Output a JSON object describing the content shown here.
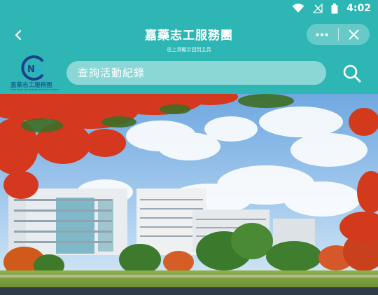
{
  "status_bar": {
    "time": "4:02"
  },
  "header": {
    "title": "嘉藥志工服務團",
    "subtitle": "往上滑顯示回到主頁"
  },
  "logo": {
    "mark": "CNU",
    "text": "嘉藥志工服務團",
    "small": "CHIA NAN VOLUNTEER SERVICE GROUP"
  },
  "search": {
    "placeholder": "查詢活動紀錄"
  },
  "colors": {
    "brand": "#2db6b4",
    "logo_blue": "#1e3f8a"
  }
}
